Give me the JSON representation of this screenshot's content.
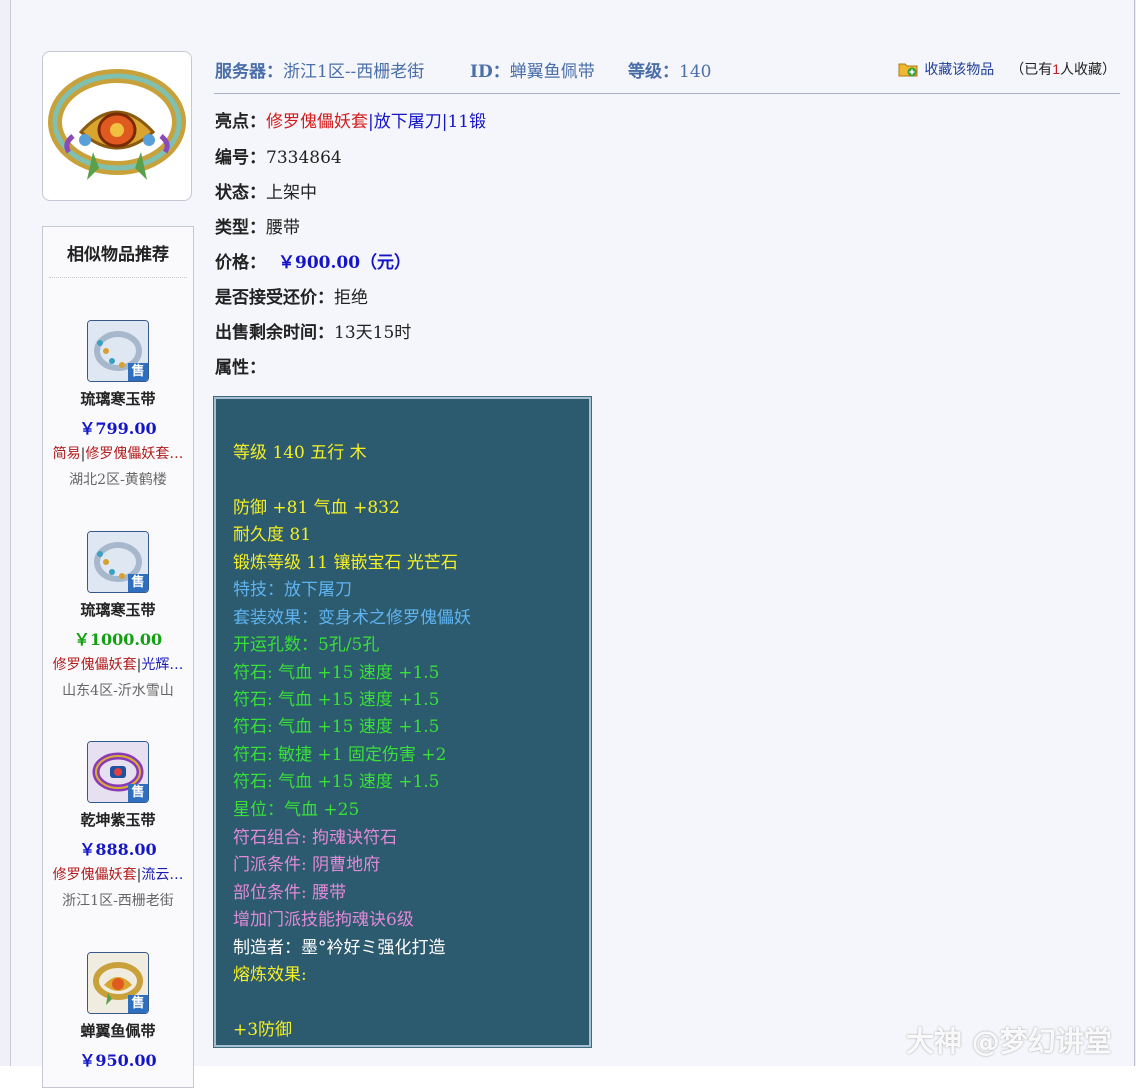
{
  "header": {
    "server_label": "服务器：",
    "server_value": "浙江1区--西栅老街",
    "id_label": "ID：",
    "id_value": "蝉翼鱼佩带",
    "level_label": "等级：",
    "level_value": "140",
    "favorite_link": "收藏该物品",
    "favorite_prefix": "（已有",
    "favorite_count": "1",
    "favorite_suffix": "人收藏）"
  },
  "details": {
    "highlight_label": "亮点：",
    "highlight_1": "修罗傀儡妖套",
    "highlight_sep1": "|",
    "highlight_2": "放下屠刀",
    "highlight_sep2": "|",
    "highlight_3": "11锻",
    "number_label": "编号：",
    "number_value": "7334864",
    "status_label": "状态：",
    "status_value": "上架中",
    "type_label": "类型：",
    "type_value": "腰带",
    "price_label": "价格：",
    "price_value": "￥900.00（元）",
    "counter_label": "是否接受还价：",
    "counter_value": "拒绝",
    "time_label": "出售剩余时间：",
    "time_value": "13天15时",
    "attr_label": "属性："
  },
  "attributes": [
    {
      "text": "等级 140 五行 木",
      "color": "yellow"
    },
    {
      "text": "防御 +81 气血 +832",
      "color": "yellow"
    },
    {
      "text": "耐久度 81",
      "color": "yellow"
    },
    {
      "text": "锻炼等级 11 镶嵌宝石 光芒石",
      "color": "yellow"
    },
    {
      "text": "特技：放下屠刀",
      "color": "cyan"
    },
    {
      "text": "套装效果：变身术之修罗傀儡妖",
      "color": "cyan"
    },
    {
      "text": "开运孔数：5孔/5孔",
      "color": "green"
    },
    {
      "text": "符石: 气血 +15 速度 +1.5",
      "color": "green"
    },
    {
      "text": "符石: 气血 +15 速度 +1.5",
      "color": "green"
    },
    {
      "text": "符石: 气血 +15 速度 +1.5",
      "color": "green"
    },
    {
      "text": "符石: 敏捷 +1 固定伤害 +2",
      "color": "green"
    },
    {
      "text": "符石: 气血 +15 速度 +1.5",
      "color": "green"
    },
    {
      "text": "星位：气血 +25",
      "color": "green"
    },
    {
      "text": "符石组合: 拘魂诀符石",
      "color": "pink"
    },
    {
      "text": "门派条件: 阴曹地府",
      "color": "pink"
    },
    {
      "text": "部位条件: 腰带",
      "color": "pink"
    },
    {
      "text": "增加门派技能拘魂诀6级",
      "color": "pink"
    },
    {
      "text": "制造者：墨°衿好ミ强化打造",
      "color": "white"
    },
    {
      "text": "熔炼效果:",
      "color": "yellow"
    },
    {
      "text": "+3防御",
      "color": "yellow"
    }
  ],
  "similar": {
    "title": "相似物品推荐",
    "sell_badge": "售",
    "items": [
      {
        "name": "琉璃寒玉带",
        "price": "￥799.00",
        "price_color": "#1515c8",
        "tag1": "简易",
        "tag1_color": "red",
        "tag2": "修罗傀儡妖套…",
        "tag2_color": "red",
        "server": "湖北2区-黄鹤楼",
        "icon": "blue-ring-belt-icon"
      },
      {
        "name": "琉璃寒玉带",
        "price": "￥1000.00",
        "price_color": "#12a012",
        "tag1": "修罗傀儡妖套",
        "tag1_color": "red",
        "tag2": "光辉…",
        "tag2_color": "blue",
        "server": "山东4区-沂水雪山",
        "icon": "blue-ring-belt-icon"
      },
      {
        "name": "乾坤紫玉带",
        "price": "￥888.00",
        "price_color": "#1515c8",
        "tag1": "修罗傀儡妖套",
        "tag1_color": "red",
        "tag2": "流云…",
        "tag2_color": "blue",
        "server": "浙江1区-西栅老街",
        "icon": "purple-ring-belt-icon"
      },
      {
        "name": "蝉翼鱼佩带",
        "price": "￥950.00",
        "price_color": "#1515c8",
        "tag1": "",
        "tag1_color": "red",
        "tag2": "",
        "tag2_color": "red",
        "server": "",
        "icon": "gold-ring-belt-icon"
      }
    ]
  },
  "watermark": "大神 @梦幻讲堂"
}
